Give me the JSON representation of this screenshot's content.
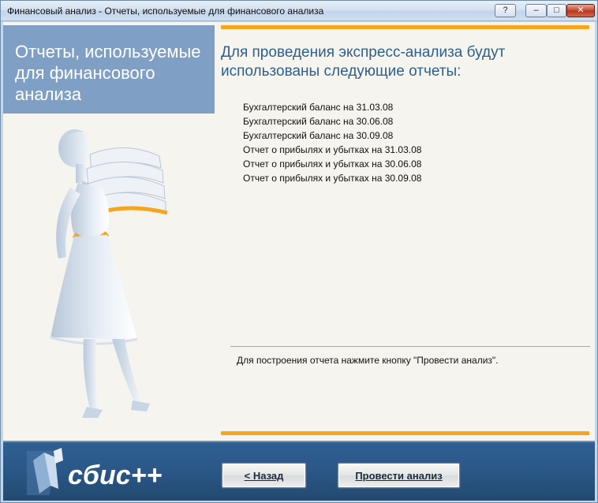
{
  "window": {
    "title": "Финансовый анализ - Отчеты, используемые для финансового анализа",
    "help_label": "?",
    "minimize_label": "–",
    "maximize_label": "□",
    "close_label": "✕"
  },
  "left_panel": {
    "header": "Отчеты, используемые для финансового анализа",
    "accent_color": "#f6a51e",
    "header_color": "#7f9fc4"
  },
  "main": {
    "heading": "Для проведения экспресс-анализа будут использованы следующие отчеты:",
    "reports": [
      "Бухгалтерский баланс на 31.03.08",
      "Бухгалтерский баланс на 30.06.08",
      "Бухгалтерский баланс на 30.09.08",
      "Отчет о прибылях и убытках на 31.03.08",
      "Отчет о прибылях и убытках на 30.06.08",
      "Отчет о прибылях и убытках на 30.09.08"
    ],
    "hint": "Для построения отчета нажмите кнопку \"Провести анализ\"."
  },
  "footer": {
    "logo_text": "сбис++",
    "back_button": "< Назад",
    "run_button": "Провести анализ"
  }
}
